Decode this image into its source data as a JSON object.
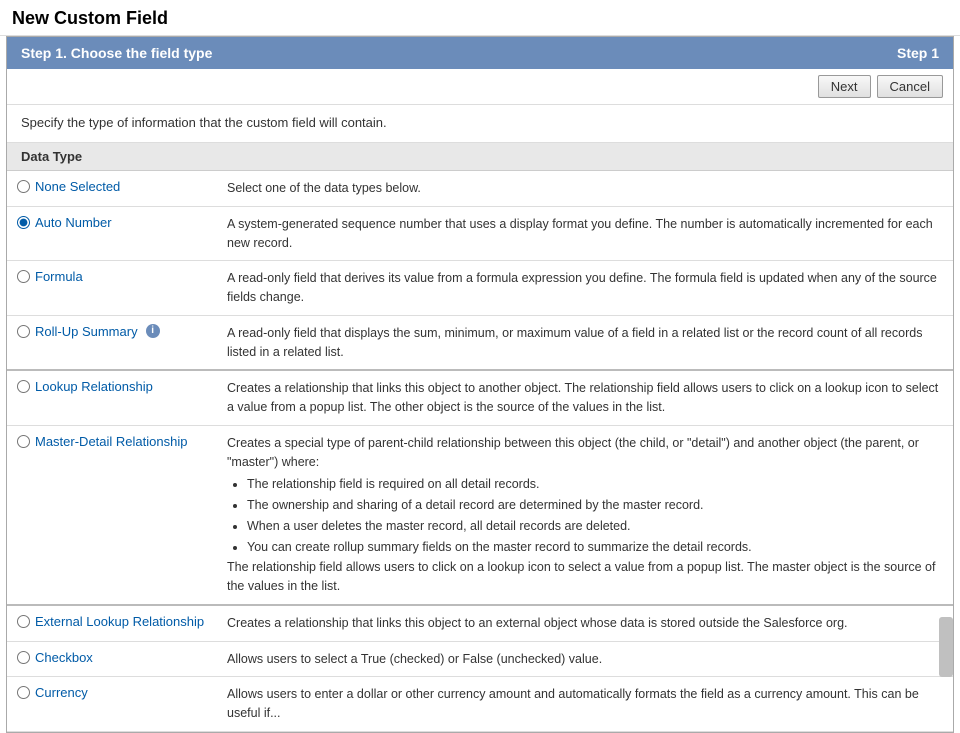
{
  "page": {
    "title": "New Custom Field"
  },
  "step_header": {
    "left": "Step 1. Choose the field type",
    "right": "Step 1"
  },
  "toolbar": {
    "next_label": "Next",
    "cancel_label": "Cancel"
  },
  "instruction": "Specify the type of information that the custom field will contain.",
  "data_type_header": "Data Type",
  "fields": [
    {
      "name": "None Selected",
      "selected": false,
      "description": "Select one of the data types below.",
      "has_info": false,
      "bullet_points": []
    },
    {
      "name": "Auto Number",
      "selected": true,
      "description": "A system-generated sequence number that uses a display format you define. The number is automatically incremented for each new record.",
      "has_info": false,
      "bullet_points": []
    },
    {
      "name": "Formula",
      "selected": false,
      "description": "A read-only field that derives its value from a formula expression you define. The formula field is updated when any of the source fields change.",
      "has_info": false,
      "bullet_points": []
    },
    {
      "name": "Roll-Up Summary",
      "selected": false,
      "description": "A read-only field that displays the sum, minimum, or maximum value of a field in a related list or the record count of all records listed in a related list.",
      "has_info": true,
      "bullet_points": []
    },
    {
      "name": "Lookup Relationship",
      "selected": false,
      "description": "Creates a relationship that links this object to another object. The relationship field allows users to click on a lookup icon to select a value from a popup list. The other object is the source of the values in the list.",
      "has_info": false,
      "bullet_points": [],
      "section_divider": true
    },
    {
      "name": "Master-Detail Relationship",
      "selected": false,
      "description": "Creates a special type of parent-child relationship between this object (the child, or \"detail\") and another object (the parent, or \"master\") where:",
      "has_info": false,
      "bullet_points": [
        "The relationship field is required on all detail records.",
        "The ownership and sharing of a detail record are determined by the master record.",
        "When a user deletes the master record, all detail records are deleted.",
        "You can create rollup summary fields on the master record to summarize the detail records."
      ],
      "extra_desc": "The relationship field allows users to click on a lookup icon to select a value from a popup list. The master object is the source of the values in the list."
    },
    {
      "name": "External Lookup Relationship",
      "selected": false,
      "description": "Creates a relationship that links this object to an external object whose data is stored outside the Salesforce org.",
      "has_info": false,
      "bullet_points": [],
      "section_divider": true
    },
    {
      "name": "Checkbox",
      "selected": false,
      "description": "Allows users to select a True (checked) or False (unchecked) value.",
      "has_info": false,
      "bullet_points": []
    },
    {
      "name": "Currency",
      "selected": false,
      "description": "Allows users to enter a dollar or other currency amount and automatically formats the field as a currency amount. This can be useful if...",
      "has_info": false,
      "bullet_points": []
    }
  ]
}
